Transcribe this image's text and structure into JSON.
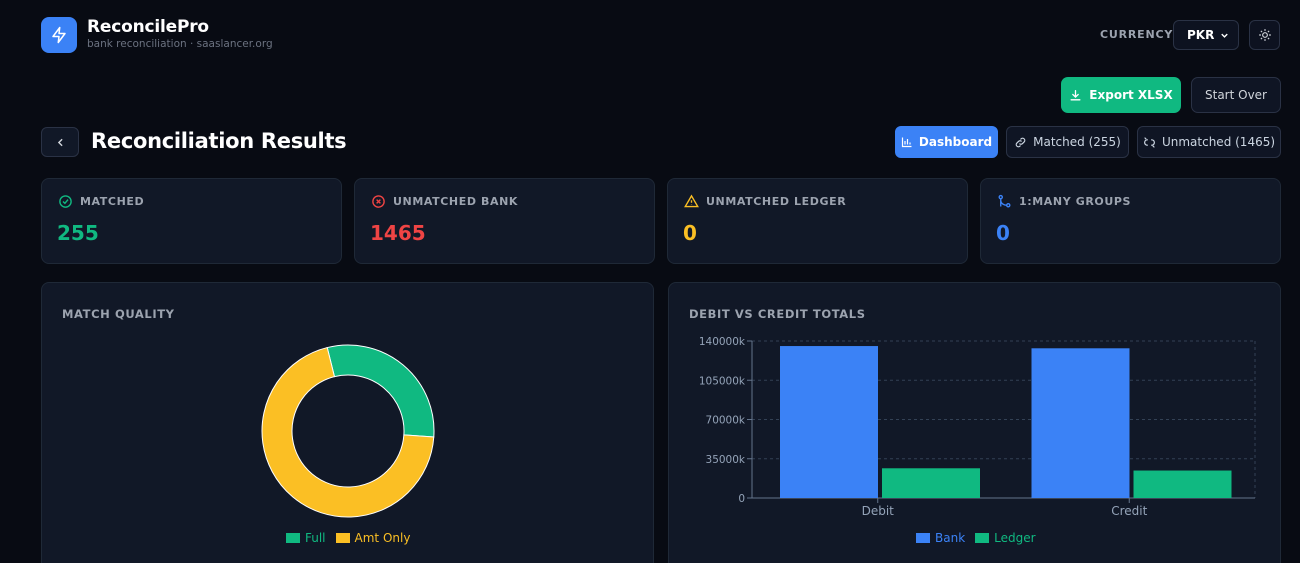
{
  "app": {
    "title": "ReconcilePro",
    "subtitle": "bank reconciliation · saaslancer.org",
    "logo_icon": "lightning-icon",
    "accent": "#3b82f6"
  },
  "header": {
    "currency_label": "CURRENCY",
    "currency_value": "PKR",
    "theme_icon": "sun-icon"
  },
  "actions": {
    "export_label": "Export XLSX",
    "start_over_label": "Start Over"
  },
  "page": {
    "title": "Reconciliation Results"
  },
  "tabs": [
    {
      "label": "Dashboard",
      "icon": "bar-chart-icon",
      "active": true
    },
    {
      "label": "Matched (255)",
      "icon": "link-icon",
      "active": false
    },
    {
      "label": "Unmatched (1465)",
      "icon": "unlink-icon",
      "active": false
    }
  ],
  "stats": [
    {
      "label": "MATCHED",
      "value": "255",
      "icon": "check-circle-icon",
      "color": "#10b981"
    },
    {
      "label": "UNMATCHED BANK",
      "value": "1465",
      "icon": "x-circle-icon",
      "color": "#ef4444"
    },
    {
      "label": "UNMATCHED LEDGER",
      "value": "0",
      "icon": "warning-icon",
      "color": "#fbbf24"
    },
    {
      "label": "1:MANY GROUPS",
      "value": "0",
      "icon": "git-merge-icon",
      "color": "#3b82f6"
    }
  ],
  "panels": {
    "match_quality_title": "MATCH QUALITY",
    "debit_credit_title": "DEBIT VS CREDIT TOTALS"
  },
  "chart_data": [
    {
      "type": "pie",
      "title": "MATCH QUALITY",
      "donut": true,
      "categories": [
        "Full",
        "Amt Only"
      ],
      "values": [
        30,
        70
      ],
      "colors": [
        "#10b981",
        "#fbbf24"
      ],
      "legend": "bottom"
    },
    {
      "type": "bar",
      "title": "DEBIT VS CREDIT TOTALS",
      "categories": [
        "Debit",
        "Credit"
      ],
      "series": [
        {
          "name": "Bank",
          "values": [
            135500,
            133500
          ],
          "color": "#3b82f6"
        },
        {
          "name": "Ledger",
          "values": [
            26500,
            24500
          ],
          "color": "#10b981"
        }
      ],
      "y_ticks": [
        "0",
        "35000k",
        "70000k",
        "105000k",
        "140000k"
      ],
      "ylim": [
        0,
        140000
      ],
      "grid": true,
      "legend": "bottom"
    }
  ]
}
